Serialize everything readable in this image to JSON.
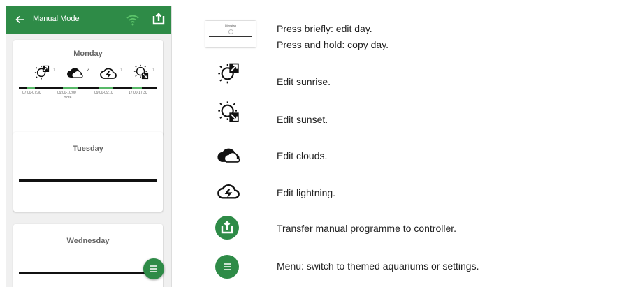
{
  "app": {
    "title": "Manual Mode",
    "accent": "#2e8b47",
    "icons": {
      "back": "arrow-left-icon",
      "wifi": "wifi-icon",
      "upload": "upload-icon",
      "menu": "menu-icon"
    }
  },
  "days": [
    {
      "name": "Monday",
      "events": [
        {
          "icon": "sunrise-icon",
          "count": "1"
        },
        {
          "icon": "clouds-icon",
          "count": "2"
        },
        {
          "icon": "lightning-icon",
          "count": "1"
        },
        {
          "icon": "sunset-icon",
          "count": "1"
        }
      ],
      "times": [
        "07:00-07:30",
        "09:00-10:00",
        "09:00-09:10",
        "17:00-17:30"
      ],
      "more": "more"
    },
    {
      "name": "Tuesday"
    },
    {
      "name": "Wednesday"
    }
  ],
  "thumb": {
    "label": "Dienstag"
  },
  "legend": [
    {
      "icon": "day-card-thumbnail",
      "lines": [
        "Press briefly: edit day.",
        "Press and hold: copy day."
      ]
    },
    {
      "icon": "sunrise-icon",
      "text": "Edit sunrise."
    },
    {
      "icon": "sunset-icon",
      "text": "Edit sunset."
    },
    {
      "icon": "clouds-icon",
      "text": "Edit clouds."
    },
    {
      "icon": "lightning-icon",
      "text": "Edit lightning."
    },
    {
      "icon": "upload-icon",
      "text": "Transfer manual programme to controller."
    },
    {
      "icon": "menu-icon",
      "text": "Menu: switch to themed aquariums or settings."
    }
  ]
}
